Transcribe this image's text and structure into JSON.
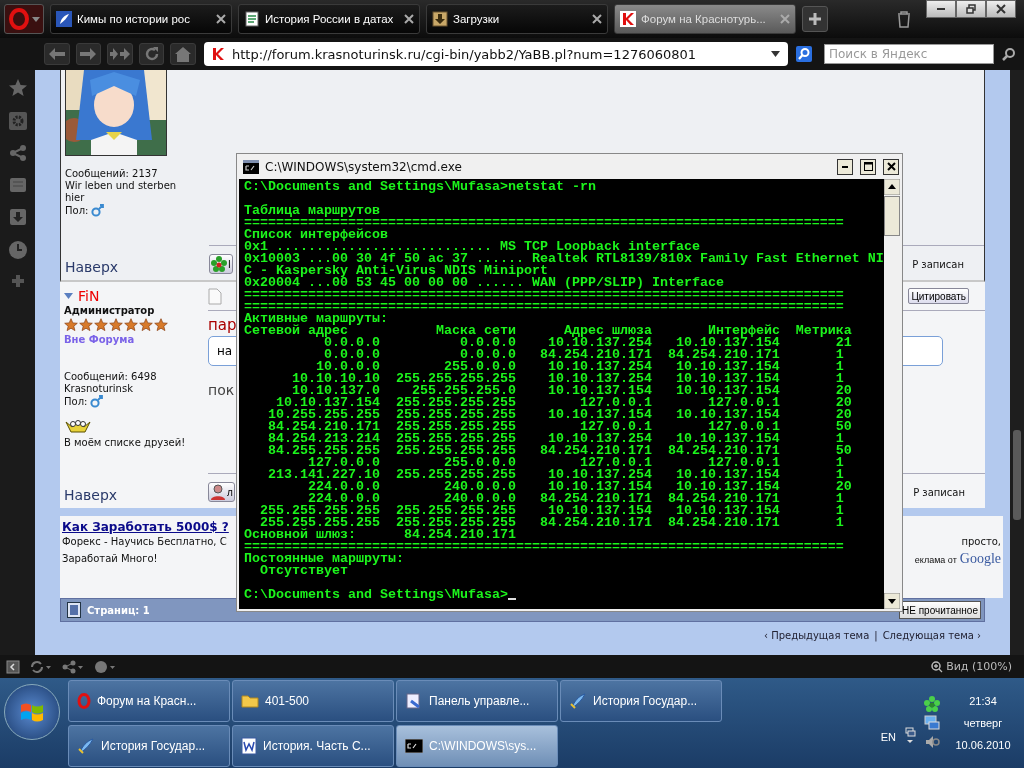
{
  "browser": {
    "tabs": [
      {
        "title": "Кимы по истории рос",
        "kind": "feather",
        "selected": false
      },
      {
        "title": "История России в датах",
        "kind": "document",
        "selected": false
      },
      {
        "title": "Загрузки",
        "kind": "download",
        "selected": false
      },
      {
        "title": "Форум на Краснотурь...",
        "kind": "k-logo",
        "selected": true
      }
    ],
    "url": "http://forum.krasnoturinsk.ru/cgi-bin/yabb2/YaBB.pl?num=1276060801",
    "search_placeholder": "Поиск в Яндекс"
  },
  "forum": {
    "posts": [
      {
        "kind": "avatar",
        "posts_count": "Сообщений: 2137",
        "signature": "Wir leben und sterben hier",
        "gender_label": "Пол:",
        "top_link": "Наверх",
        "action_fragment": "I",
        "ip_note": "P записан"
      },
      {
        "kind": "member",
        "name": "FiN",
        "role": "Администратор",
        "stars": 7,
        "status": "Вне Форума",
        "posts_count": "Сообщений: 6498",
        "location": "Krasnoturinsk",
        "gender_label": "Пол:",
        "friends": "В моём списке друзей!",
        "top_link": "Наверх",
        "quote_button": "Цитировать",
        "subject_fragment": "пар",
        "reply_fragment": "на",
        "body_fragment": "пок",
        "action_fragment": "л",
        "ip_note": "P записан"
      }
    ],
    "ad": {
      "title": "Как Заработать 5000$ ?",
      "text": "Форекс - Научись Бесплатно, С",
      "text_end": "просто,",
      "text_line2": "Заработай Много!",
      "credit": "еклама от",
      "credit_logo": "Google"
    },
    "pages": "Страниц: 1",
    "unread_button": "НЕ прочитанное",
    "prev_topic": "‹ Предыдущая тема",
    "separator": "|",
    "next_topic": "Следующая тема ›"
  },
  "cmd": {
    "title": "C:\\WINDOWS\\system32\\cmd.exe",
    "output": [
      {
        "kind": "line",
        "text": "C:\\Documents and Settings\\Mufasa>netstat -rn"
      },
      {
        "kind": "blank"
      },
      {
        "kind": "line",
        "text": "Таблица маршрутов"
      },
      {
        "kind": "line",
        "text": "==========================================================================="
      },
      {
        "kind": "line",
        "text": "Список интерфейсов"
      },
      {
        "kind": "line",
        "text": "0x1 ........................... MS TCP Loopback interface"
      },
      {
        "kind": "line",
        "text": "0x10003 ...00 30 4f 50 ac 37 ...... Realtek RTL8139/810x Family Fast Ethernet NI"
      },
      {
        "kind": "line",
        "text": "C - Kaspersky Anti-Virus NDIS Miniport"
      },
      {
        "kind": "line",
        "text": "0x20004 ...00 53 45 00 00 00 ...... WAN (PPP/SLIP) Interface"
      },
      {
        "kind": "line",
        "text": "==========================================================================="
      },
      {
        "kind": "line",
        "text": "==========================================================================="
      },
      {
        "kind": "line",
        "text": "Активные маршруты:"
      },
      {
        "kind": "header",
        "cells": [
          "Сетевой адрес",
          "Маска сети",
          "Адрес шлюза",
          "Интерфейс",
          "Метрика"
        ]
      },
      {
        "kind": "route",
        "cells": [
          "0.0.0.0",
          "0.0.0.0",
          "10.10.137.254",
          "10.10.137.154",
          "21"
        ]
      },
      {
        "kind": "route",
        "cells": [
          "0.0.0.0",
          "0.0.0.0",
          "84.254.210.171",
          "84.254.210.171",
          "1"
        ]
      },
      {
        "kind": "route",
        "cells": [
          "10.0.0.0",
          "255.0.0.0",
          "10.10.137.254",
          "10.10.137.154",
          "1"
        ]
      },
      {
        "kind": "route",
        "cells": [
          "10.10.10.10",
          "255.255.255.255",
          "10.10.137.254",
          "10.10.137.154",
          "1"
        ]
      },
      {
        "kind": "route",
        "cells": [
          "10.10.137.0",
          "255.255.255.0",
          "10.10.137.154",
          "10.10.137.154",
          "20"
        ]
      },
      {
        "kind": "route",
        "cells": [
          "10.10.137.154",
          "255.255.255.255",
          "127.0.0.1",
          "127.0.0.1",
          "20"
        ]
      },
      {
        "kind": "route",
        "cells": [
          "10.255.255.255",
          "255.255.255.255",
          "10.10.137.154",
          "10.10.137.154",
          "20"
        ]
      },
      {
        "kind": "route",
        "cells": [
          "84.254.210.171",
          "255.255.255.255",
          "127.0.0.1",
          "127.0.0.1",
          "50"
        ]
      },
      {
        "kind": "route",
        "cells": [
          "84.254.213.214",
          "255.255.255.255",
          "10.10.137.254",
          "10.10.137.154",
          "1"
        ]
      },
      {
        "kind": "route",
        "cells": [
          "84.255.255.255",
          "255.255.255.255",
          "84.254.210.171",
          "84.254.210.171",
          "50"
        ]
      },
      {
        "kind": "route",
        "cells": [
          "127.0.0.0",
          "255.0.0.0",
          "127.0.0.1",
          "127.0.0.1",
          "1"
        ]
      },
      {
        "kind": "route",
        "cells": [
          "213.141.227.10",
          "255.255.255.255",
          "10.10.137.254",
          "10.10.137.154",
          "1"
        ]
      },
      {
        "kind": "route",
        "cells": [
          "224.0.0.0",
          "240.0.0.0",
          "10.10.137.154",
          "10.10.137.154",
          "20"
        ]
      },
      {
        "kind": "route",
        "cells": [
          "224.0.0.0",
          "240.0.0.0",
          "84.254.210.171",
          "84.254.210.171",
          "1"
        ]
      },
      {
        "kind": "route",
        "cells": [
          "255.255.255.255",
          "255.255.255.255",
          "10.10.137.154",
          "10.10.137.154",
          "1"
        ]
      },
      {
        "kind": "route",
        "cells": [
          "255.255.255.255",
          "255.255.255.255",
          "84.254.210.171",
          "84.254.210.171",
          "1"
        ]
      },
      {
        "kind": "gateway",
        "label": "Основной шлюз:",
        "value": "84.254.210.171"
      },
      {
        "kind": "line",
        "text": "==========================================================================="
      },
      {
        "kind": "line",
        "text": "Постоянные маршруты:"
      },
      {
        "kind": "line",
        "text": "  Отсутствует"
      },
      {
        "kind": "blank"
      },
      {
        "kind": "prompt",
        "text": "C:\\Documents and Settings\\Mufasa>"
      }
    ]
  },
  "status_bar": {
    "zoom": "Вид (100%)"
  },
  "taskbar": {
    "buttons": [
      {
        "label": "Форум на Красн...",
        "kind": "opera",
        "selected": false
      },
      {
        "label": "401-500",
        "kind": "folder",
        "selected": false
      },
      {
        "label": "Панель управле...",
        "kind": "control-panel",
        "selected": false
      },
      {
        "label": "История Государ...",
        "kind": "feather",
        "selected": false
      },
      {
        "label": "История Государ...",
        "kind": "feather",
        "selected": false
      },
      {
        "label": "История. Часть С...",
        "kind": "word",
        "selected": false
      },
      {
        "label": "C:\\WINDOWS\\sys...",
        "kind": "cmd",
        "selected": true
      }
    ],
    "language": "EN",
    "time": "21:34",
    "day": "четверг",
    "date": "10.06.2010"
  }
}
